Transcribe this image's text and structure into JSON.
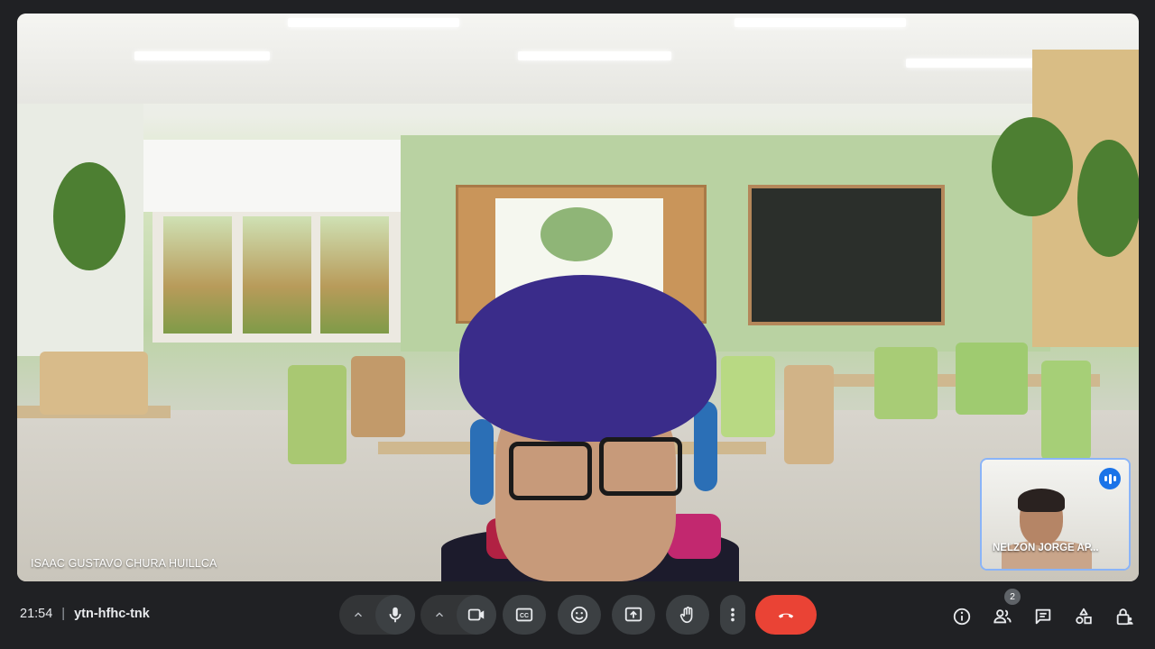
{
  "main_participant": {
    "name": "ISAAC GUSTAVO CHURA HUILLCA"
  },
  "self_tile": {
    "name": "NELZON JORGE AP...",
    "speaking_icon": "audio-level-icon"
  },
  "meeting": {
    "time": "21:54",
    "separator": "|",
    "code": "ytn-hfhc-tnk"
  },
  "controls": {
    "mic": "microphone-icon",
    "camera": "videocam-icon",
    "captions": "closed-captions-icon",
    "reactions": "emoji-icon",
    "present": "present-screen-icon",
    "raise_hand": "raise-hand-icon",
    "more": "more-vert-icon",
    "leave": "call-end-icon"
  },
  "side_panel": {
    "info": "info-icon",
    "people": "people-icon",
    "people_count": "2",
    "chat": "chat-icon",
    "activities": "activities-icon",
    "host_controls": "lock-person-icon"
  },
  "colors": {
    "background": "#202124",
    "end_call": "#ea4335",
    "accent": "#1a73e8",
    "tile_border": "#8ab4f8"
  }
}
